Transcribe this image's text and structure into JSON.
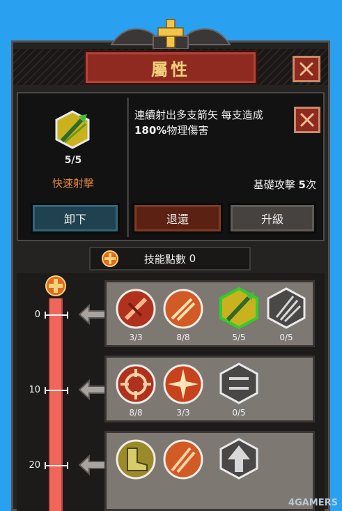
{
  "header": {
    "title": "屬性"
  },
  "skill": {
    "level": "5/5",
    "name": "快速射擊",
    "description_line1": "連續射出多支箭矢 每支造成",
    "description_percent": "180%",
    "description_line2_rest": "物理傷害",
    "base_attack_label": "基礎攻擊",
    "base_attack_count": "5",
    "base_attack_unit": "次"
  },
  "buttons": {
    "unequip": "卸下",
    "refund": "退還",
    "upgrade": "升級"
  },
  "skill_points": {
    "label": "技能點數",
    "value": "0"
  },
  "tree": {
    "tiers": [
      {
        "level": "0",
        "skills": [
          {
            "icon": "sword-strike-icon",
            "count": "3/3"
          },
          {
            "icon": "slash-wave-icon",
            "count": "8/8"
          },
          {
            "icon": "rapid-shot-icon",
            "count": "5/5"
          },
          {
            "icon": "triple-claw-icon",
            "count": "0/5"
          }
        ]
      },
      {
        "level": "10",
        "skills": [
          {
            "icon": "crosshair-icon",
            "count": "8/8"
          },
          {
            "icon": "burst-star-icon",
            "count": "3/3"
          },
          {
            "icon": "chain-link-icon",
            "count": "0/5"
          }
        ]
      },
      {
        "level": "20",
        "skills": [
          {
            "icon": "boot-speed-icon",
            "count": ""
          },
          {
            "icon": "flame-slash-icon",
            "count": ""
          },
          {
            "icon": "arrow-up-icon",
            "count": ""
          }
        ]
      }
    ]
  },
  "watermark": "4GAMERS",
  "colors": {
    "title_bg": "#8f2a21",
    "title_text": "#f3d27a",
    "skill_name": "#e08a3e",
    "track": "#f0665a",
    "bg": "#2aa0f0"
  }
}
